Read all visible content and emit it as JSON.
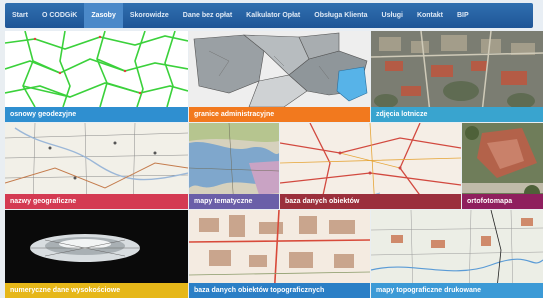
{
  "nav": {
    "items": [
      {
        "label": "Start"
      },
      {
        "label": "O CODGiK"
      },
      {
        "label": "Zasoby",
        "active": true
      },
      {
        "label": "Skorowidze"
      },
      {
        "label": "Dane bez opłat"
      },
      {
        "label": "Kalkulator Opłat"
      },
      {
        "label": "Obsługa Klienta"
      },
      {
        "label": "Usługi"
      },
      {
        "label": "Kontakt"
      },
      {
        "label": "BIP"
      }
    ]
  },
  "tiles": [
    {
      "label": "osnowy geodezyjne",
      "color": "#2f8fd0"
    },
    {
      "label": "granice administracyjne",
      "color": "#f2791e"
    },
    {
      "label": "zdjęcia lotnicze",
      "color": "#39a4cf"
    },
    {
      "label": "nazwy geograficzne",
      "color": "#d43a52"
    },
    {
      "label": "mapy tematyczne",
      "color": "#6a5fa8"
    },
    {
      "label": "baza danych obiektów",
      "color": "#9b2f3c"
    },
    {
      "label": "ortofotomapa",
      "color": "#8f1f5e"
    },
    {
      "label": "numeryczne dane wysokościowe",
      "color": "#e6b719"
    },
    {
      "label": "baza danych obiektów topograficznych",
      "color": "#2b7fc6"
    },
    {
      "label": "mapy topograficzne drukowane",
      "color": "#3c9ad6"
    }
  ]
}
